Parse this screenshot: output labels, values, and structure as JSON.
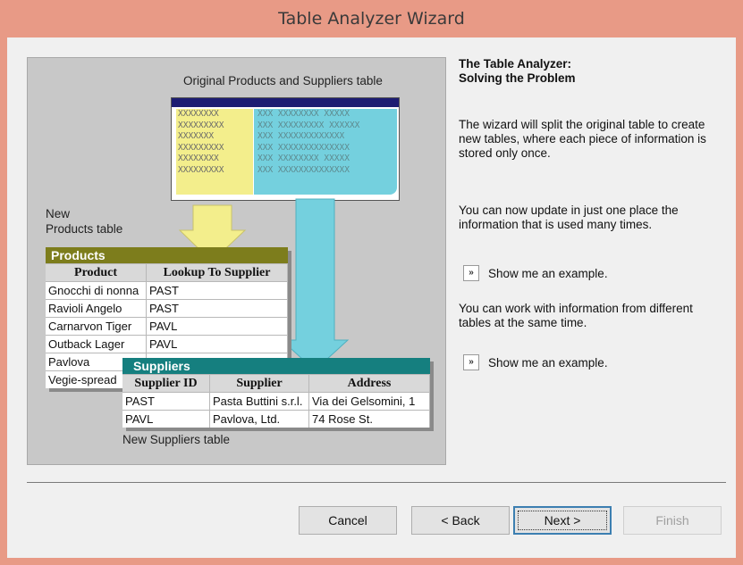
{
  "window": {
    "title": "Table Analyzer Wizard"
  },
  "illustration": {
    "original_caption": "Original Products and Suppliers table",
    "yellow_rows": [
      "XXXXXXXX",
      "XXXXXXXXX",
      "XXXXXXX",
      "XXXXXXXXX",
      "XXXXXXXX",
      "XXXXXXXXX"
    ],
    "cyan_rows": [
      "XXX XXXXXXXX XXXXX",
      "XXX XXXXXXXXX XXXXXX",
      "XXX XXXXXXXXXXXXX",
      "XXX XXXXXXXXXXXXXX",
      "XXX XXXXXXXX XXXXX",
      "XXX XXXXXXXXXXXXXX"
    ],
    "new_products_label_line1": "New",
    "new_products_label_line2": "Products table",
    "new_suppliers_label": "New Suppliers table",
    "products_table": {
      "title": "Products",
      "headers": [
        "Product",
        "Lookup To Supplier"
      ],
      "rows": [
        [
          "Gnocchi di nonna",
          "PAST"
        ],
        [
          "Ravioli Angelo",
          "PAST"
        ],
        [
          "Carnarvon Tiger",
          "PAVL"
        ],
        [
          "Outback Lager",
          "PAVL"
        ],
        [
          "Pavlova",
          ""
        ],
        [
          "Vegie-spread",
          ""
        ]
      ]
    },
    "suppliers_table": {
      "title": "Suppliers",
      "headers": [
        "Supplier ID",
        "Supplier",
        "Address"
      ],
      "rows": [
        [
          "PAST",
          "Pasta Buttini s.r.l.",
          "Via dei Gelsomini, 1"
        ],
        [
          "PAVL",
          "Pavlova, Ltd.",
          "74 Rose St."
        ]
      ]
    }
  },
  "right_pane": {
    "title_line1": "The Table Analyzer:",
    "title_line2": "Solving the Problem",
    "para1": "The wizard will split the original table to create new tables, where each piece of information is stored only once.",
    "para2": "You can now update in just one place the information that is used many times.",
    "example1": "Show me an example.",
    "para3": "You can work with information from different tables at the same time.",
    "example2": "Show me an example.",
    "example_btn_glyph": "»"
  },
  "buttons": {
    "cancel": "Cancel",
    "back": "< Back",
    "next": "Next >",
    "finish": "Finish"
  },
  "colors": {
    "products_title_bg": "#7d7d1c",
    "suppliers_title_bg": "#157f7f",
    "title_bar": "#e89a86"
  }
}
